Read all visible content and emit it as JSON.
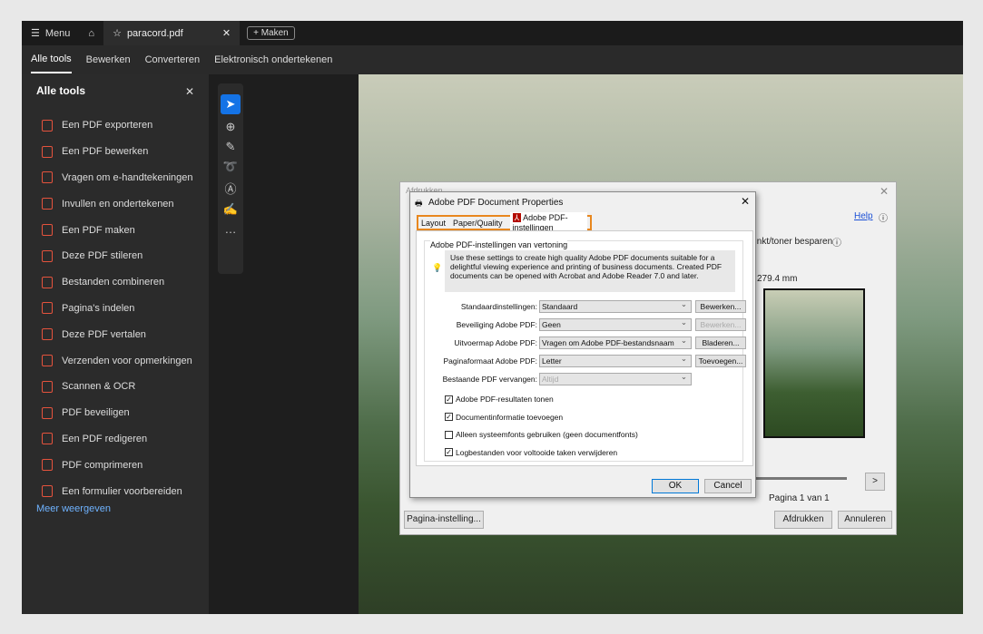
{
  "topbar": {
    "menu": "Menu",
    "tab_title": "paracord.pdf",
    "new": "Maken"
  },
  "nav": [
    "Alle tools",
    "Bewerken",
    "Converteren",
    "Elektronisch ondertekenen"
  ],
  "left": {
    "title": "Alle tools",
    "items": [
      "Een PDF exporteren",
      "Een PDF bewerken",
      "Vragen om e-handtekeningen",
      "Invullen en ondertekenen",
      "Een PDF maken",
      "Deze PDF stileren",
      "Bestanden combineren",
      "Pagina's indelen",
      "Deze PDF vertalen",
      "Verzenden voor opmerkingen",
      "Scannen & OCR",
      "PDF beveiligen",
      "Een PDF redigeren",
      "PDF comprimeren",
      "Een formulier voorbereiden"
    ],
    "more": "Meer weergeven"
  },
  "print": {
    "title": "Afdrukken",
    "help": "Help",
    "toner": "Inkt/toner besparen",
    "size": "279.4 mm",
    "page": "Pagina 1 van 1",
    "next": ">",
    "setup": "Pagina-instelling...",
    "print": "Afdrukken",
    "cancel": "Annuleren"
  },
  "props": {
    "title": "Adobe PDF Document Properties",
    "tabs": [
      "Layout",
      "Paper/Quality",
      "Adobe PDF-instellingen"
    ],
    "group": "Adobe PDF-instellingen van vertoning",
    "info": "Use these settings to create high quality Adobe PDF documents suitable for a delightful viewing experience and printing of business documents.  Created PDF documents can be opened with Acrobat and Adobe Reader 7.0 and later.",
    "rows": [
      {
        "label": "Standaardinstellingen:",
        "value": "Standaard",
        "button": "Bewerken..."
      },
      {
        "label": "Beveiliging Adobe PDF:",
        "value": "Geen",
        "button": "Bewerken..."
      },
      {
        "label": "Uitvoermap Adobe PDF:",
        "value": "Vragen om Adobe PDF-bestandsnaam",
        "button": "Bladeren..."
      },
      {
        "label": "Paginaformaat Adobe PDF:",
        "value": "Letter",
        "button": "Toevoegen..."
      },
      {
        "label": "Bestaande PDF vervangen:",
        "value": "Altijd"
      }
    ],
    "checks": [
      {
        "label": "Adobe PDF-resultaten tonen",
        "checked": true,
        "mark": "✓"
      },
      {
        "label": "Documentinformatie toevoegen",
        "checked": true,
        "mark": "✓"
      },
      {
        "label": "Alleen systeemfonts gebruiken (geen documentfonts)",
        "checked": false,
        "mark": ""
      },
      {
        "label": "Logbestanden voor voltooide taken verwijderen",
        "checked": true,
        "mark": "✓"
      }
    ],
    "ok": "OK",
    "cancel": "Cancel"
  }
}
